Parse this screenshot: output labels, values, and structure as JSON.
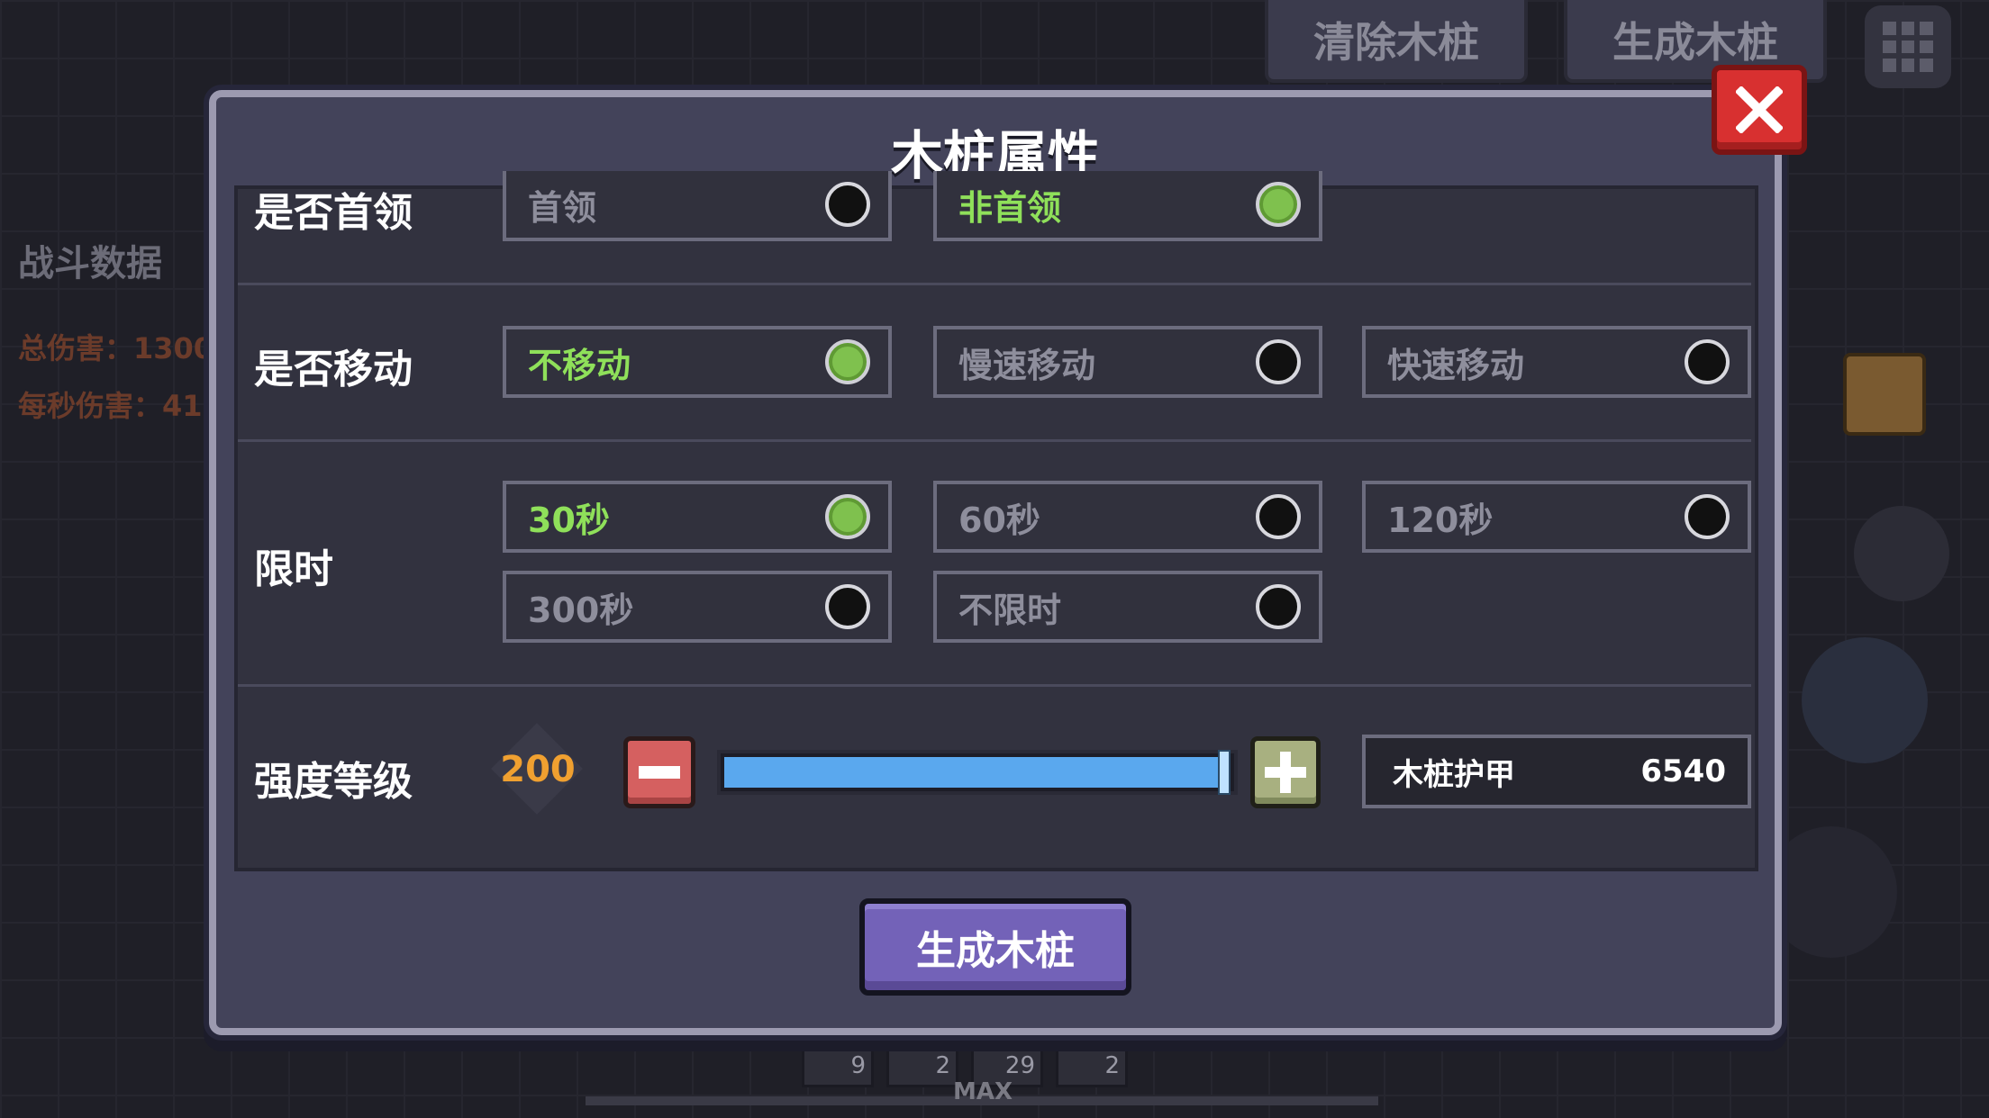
{
  "top_bar": {
    "clear_stakes": "清除木桩",
    "spawn_stakes": "生成木桩",
    "menu_icon": "grid-menu-icon"
  },
  "left_stats": {
    "title": "战斗数据",
    "total_damage": "总伤害：1300",
    "dps": "每秒伤害：41"
  },
  "bottom_hud": {
    "max_label": "MAX",
    "slots": [
      "9",
      "2",
      "29",
      "2"
    ]
  },
  "dialog": {
    "title": "木桩属性",
    "close_icon": "close-x-icon",
    "rows": {
      "boss": {
        "label": "是否首领",
        "options": [
          {
            "label": "首领",
            "selected": false
          },
          {
            "label": "非首领",
            "selected": true
          }
        ]
      },
      "move": {
        "label": "是否移动",
        "options": [
          {
            "label": "不移动",
            "selected": true
          },
          {
            "label": "慢速移动",
            "selected": false
          },
          {
            "label": "快速移动",
            "selected": false
          }
        ]
      },
      "time": {
        "label": "限时",
        "options": [
          {
            "label": "30秒",
            "selected": true
          },
          {
            "label": "60秒",
            "selected": false
          },
          {
            "label": "120秒",
            "selected": false
          },
          {
            "label": "300秒",
            "selected": false
          },
          {
            "label": "不限时",
            "selected": false
          }
        ]
      },
      "strength": {
        "label": "强度等级",
        "level": "200",
        "slider_fraction": 1.0,
        "armor_label": "木桩护甲",
        "armor_value": "6540"
      }
    },
    "spawn_button": "生成木桩"
  },
  "colors": {
    "selected_text": "#8fe05a",
    "selected_radio": "#7fc14e",
    "close_button": "#d83030",
    "slider_fill": "#5aa8ee",
    "spawn_button": "#7362b8",
    "level_text": "#f0a030"
  }
}
